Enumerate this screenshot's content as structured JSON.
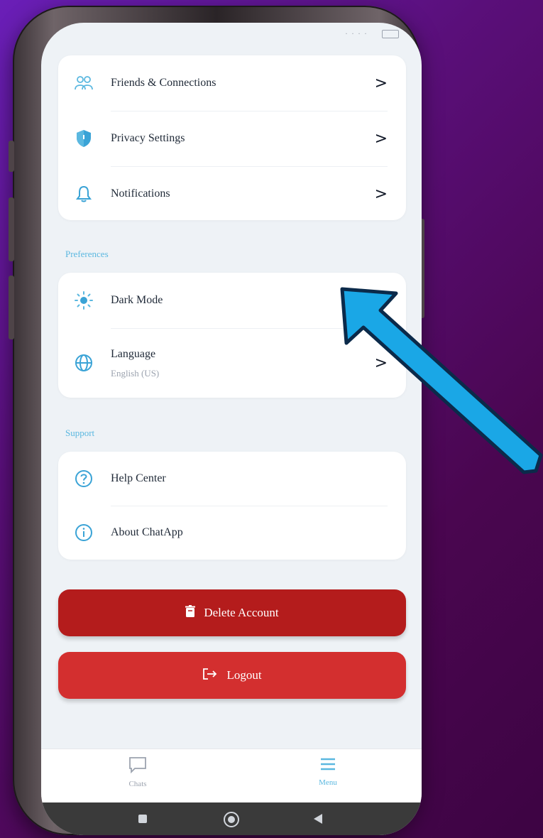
{
  "account_items": [
    {
      "label": "Friends & Connections",
      "icon": "friends-icon"
    },
    {
      "label": "Privacy Settings",
      "icon": "shield-icon"
    },
    {
      "label": "Notifications",
      "icon": "bell-icon"
    }
  ],
  "preferences": {
    "section_label": "Preferences",
    "dark_mode_label": "Dark Mode",
    "language_label": "Language",
    "language_value": "English (US)"
  },
  "support": {
    "section_label": "Support",
    "help_label": "Help Center",
    "about_label": "About ChatApp"
  },
  "actions": {
    "delete_label": "Delete Account",
    "logout_label": "Logout"
  },
  "bottom_nav": {
    "chats_label": "Chats",
    "menu_label": "Menu"
  },
  "colors": {
    "accent": "#5bb8e0",
    "delete": "#b41c1c",
    "logout": "#d32f2f",
    "annotation_arrow": "#1aa7e6"
  }
}
